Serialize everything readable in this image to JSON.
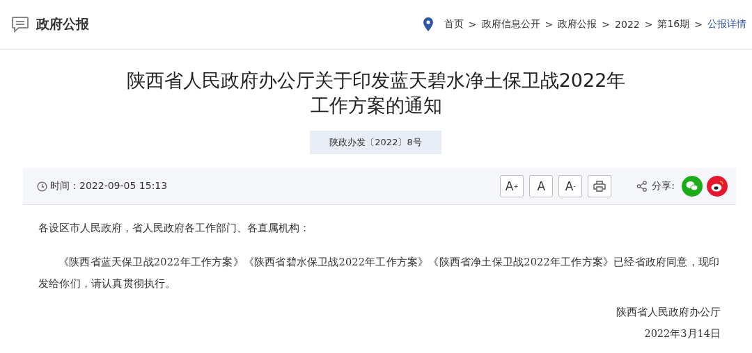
{
  "header": {
    "title": "政府公报",
    "breadcrumb": [
      {
        "label": "首页",
        "selected": false
      },
      {
        "label": "政府信息公开",
        "selected": false
      },
      {
        "label": "政府公报",
        "selected": false
      },
      {
        "label": "2022",
        "selected": false
      },
      {
        "label": "第16期",
        "selected": false
      },
      {
        "label": "公报详情",
        "selected": true
      }
    ],
    "separator": ">"
  },
  "article": {
    "title_lines": [
      "陕西省人民政府办公厅关于印发蓝天碧水净土保卫战2022年",
      "工作方案的通知"
    ],
    "doc_number": "陕政办发〔2022〕8号",
    "info_bar": {
      "time": "时间：2022-09-05 15:13",
      "font_buttons": [
        "A$^{+}$",
        "A",
        "A$^{-}$"
      ],
      "share_label": "分享:"
    },
    "salutation": "各设区市人民政府，省人民政府各工作部门、各直属机构：",
    "paragraphs": [
      "《陕西省蓝天保卫战2022年工作方案》《陕西省碧水保卫战2022年工作方案》《陕西省净土保卫战2022年工作方案》已经省政府同意，现印发给你们，请认真贯彻执行。"
    ],
    "signature": "陕西省人民政府办公厅",
    "date": "2022年3月14日"
  }
}
